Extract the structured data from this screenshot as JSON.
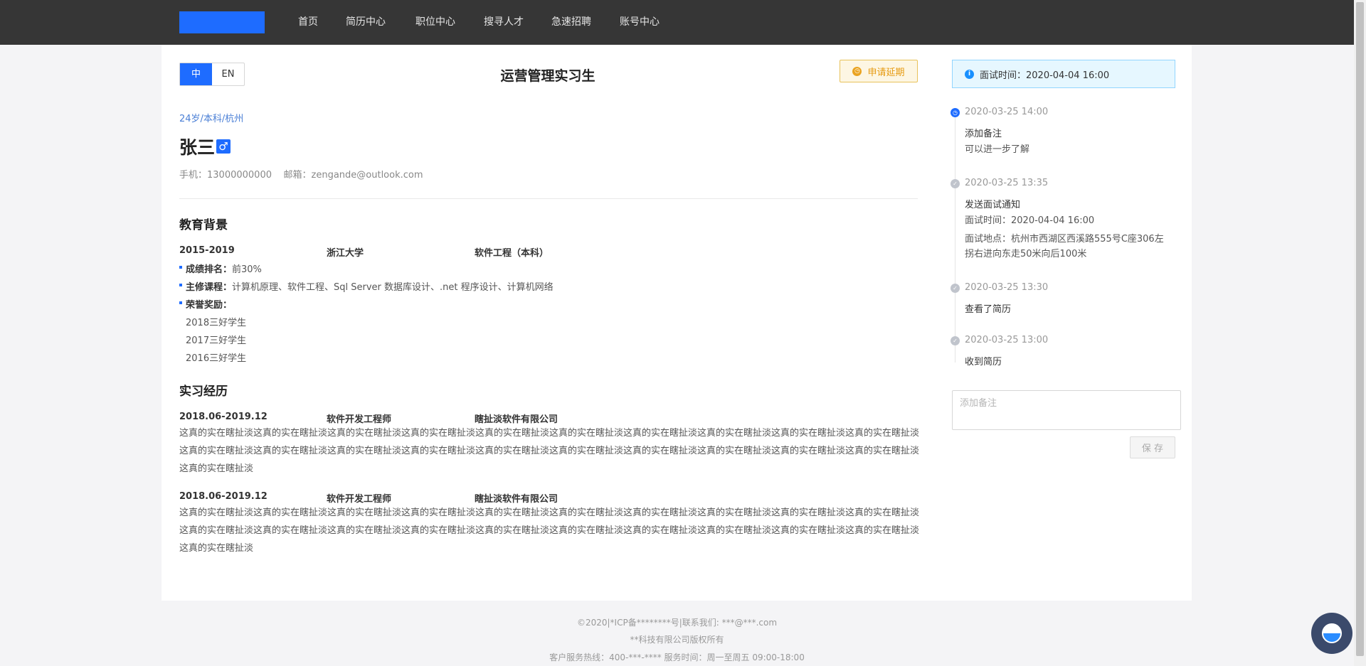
{
  "nav": [
    "首页",
    "简历中心",
    "职位中心",
    "搜寻人才",
    "急速招聘",
    "账号中心"
  ],
  "lang": {
    "zh": "中",
    "en": "EN"
  },
  "job_title": "运营管理实习生",
  "apply_extension": "申请延期",
  "interview_notice": "面试时间：2020-04-04 16:00",
  "candidate": {
    "meta": "24岁/本科/杭州",
    "name": "张三",
    "gender_icon": "♂",
    "contact": "手机：13000000000    邮箱：zengande@outlook.com"
  },
  "education": {
    "title": "教育背景",
    "period": "2015-2019",
    "school": "浙江大学",
    "major": "软件工程（本科）",
    "rank_label": "成绩排名：",
    "rank_value": "前30%",
    "courses_label": "主修课程：",
    "courses_value": "计算机原理、软件工程、Sql Server 数据库设计、.net 程序设计、计算机网络",
    "awards_label": "荣誉奖励：",
    "awards": [
      "2018三好学生",
      "2017三好学生",
      "2016三好学生"
    ]
  },
  "internship": {
    "title": "实习经历",
    "items": [
      {
        "period": "2018.06-2019.12",
        "role": "软件开发工程师",
        "company": "瞎扯淡软件有限公司",
        "desc": "这真的实在瞎扯淡这真的实在瞎扯淡这真的实在瞎扯淡这真的实在瞎扯淡这真的实在瞎扯淡这真的实在瞎扯淡这真的实在瞎扯淡这真的实在瞎扯淡这真的实在瞎扯淡这真的实在瞎扯淡这真的实在瞎扯淡这真的实在瞎扯淡这真的实在瞎扯淡这真的实在瞎扯淡这真的实在瞎扯淡这真的实在瞎扯淡这真的实在瞎扯淡这真的实在瞎扯淡这真的实在瞎扯淡这真的实在瞎扯淡这真的实在瞎扯淡"
      },
      {
        "period": "2018.06-2019.12",
        "role": "软件开发工程师",
        "company": "瞎扯淡软件有限公司",
        "desc": "这真的实在瞎扯淡这真的实在瞎扯淡这真的实在瞎扯淡这真的实在瞎扯淡这真的实在瞎扯淡这真的实在瞎扯淡这真的实在瞎扯淡这真的实在瞎扯淡这真的实在瞎扯淡这真的实在瞎扯淡这真的实在瞎扯淡这真的实在瞎扯淡这真的实在瞎扯淡这真的实在瞎扯淡这真的实在瞎扯淡这真的实在瞎扯淡这真的实在瞎扯淡这真的实在瞎扯淡这真的实在瞎扯淡这真的实在瞎扯淡这真的实在瞎扯淡"
      }
    ]
  },
  "timeline": [
    {
      "time": "2020-03-25 14:00",
      "title": "添加备注",
      "lines": [
        "可以进一步了解"
      ]
    },
    {
      "time": "2020-03-25 13:35",
      "title": "发送面试通知",
      "lines": [
        "面试时间：2020-04-04 16:00",
        "面试地点：杭州市西湖区西溪路555号C座306左拐右进向东走50米向后100米"
      ]
    },
    {
      "time": "2020-03-25 13:30",
      "title": "查看了简历",
      "lines": []
    },
    {
      "time": "2020-03-25 13:00",
      "title": "收到简历",
      "lines": []
    }
  ],
  "note": {
    "placeholder": "添加备注",
    "save": "保 存"
  },
  "footer": [
    "©2020|*ICP备********号|联系我们: ***@***.com",
    "**科技有限公司版权所有",
    "客户服务热线：400-***-**** 服务时间：周一至周五 09:00-18:00"
  ],
  "colors": {
    "topbar": "#363636",
    "accent": "#1e6cff",
    "warning": "#e69a10",
    "info_bg": "#e6f7ff"
  }
}
